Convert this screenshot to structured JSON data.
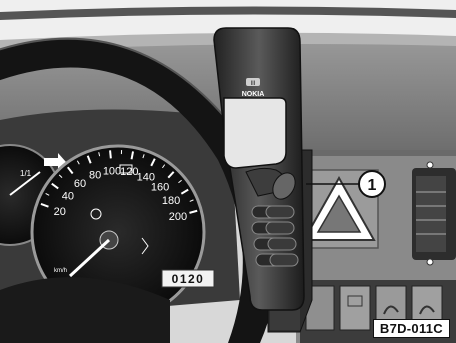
{
  "figure": {
    "code": "B7D-011C",
    "callout": "1"
  },
  "phone": {
    "brand": "NOKIA",
    "badge": "III"
  },
  "speedometer": {
    "ticks": [
      "20",
      "40",
      "60",
      "80",
      "100",
      "120",
      "140",
      "160",
      "180",
      "200"
    ],
    "unit": "km/h",
    "odometer": "0120"
  },
  "tachometer": {
    "labels": [
      "1/1"
    ]
  }
}
